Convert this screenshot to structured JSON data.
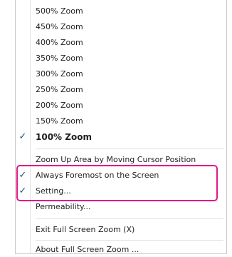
{
  "menu": {
    "zoom_items": [
      {
        "label": "500% Zoom",
        "checked": false
      },
      {
        "label": "450% Zoom",
        "checked": false
      },
      {
        "label": "400% Zoom",
        "checked": false
      },
      {
        "label": "350% Zoom",
        "checked": false
      },
      {
        "label": "300% Zoom",
        "checked": false
      },
      {
        "label": "250% Zoom",
        "checked": false
      },
      {
        "label": "200% Zoom",
        "checked": false
      },
      {
        "label": "150% Zoom",
        "checked": false
      },
      {
        "label": "100% Zoom",
        "checked": true,
        "bold": true
      }
    ],
    "options": [
      {
        "label": "Zoom Up Area by Moving Cursor Position",
        "checked": false
      },
      {
        "label": "Always Foremost on the Screen",
        "checked": true
      },
      {
        "label": "Setting...",
        "checked": true
      },
      {
        "label": "Permeability...",
        "checked": false
      }
    ],
    "exit": {
      "label": "Exit Full Screen Zoom (X)"
    },
    "about": {
      "label": "About Full Screen Zoom ..."
    },
    "check_glyph": "✓"
  },
  "colors": {
    "highlight_border": "#e0188a",
    "check": "#1a4b8f"
  }
}
